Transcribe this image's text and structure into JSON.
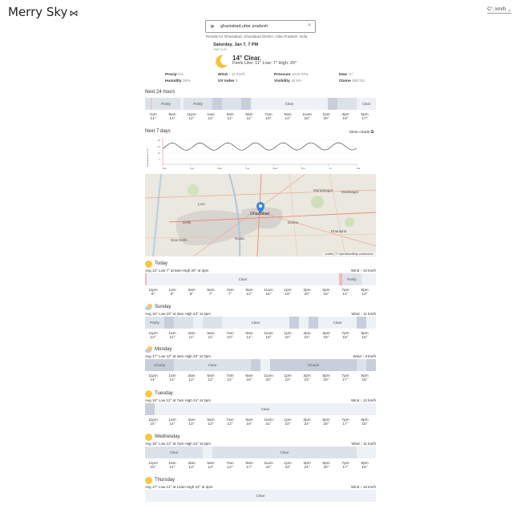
{
  "header": {
    "logo": "Merry Sky",
    "logo_icon": "butterfly-icon",
    "units": "C°, km/h"
  },
  "search": {
    "value": "ghaziabad,uttar pradesh",
    "results_text": "Results for Ghaziabad, Ghaziabad District, Uttar Pradesh, India"
  },
  "current": {
    "date": "Saturday, Jan 7, 7 PM",
    "tz": "GMT+5:30",
    "summary": "14° Clear.",
    "feels": "Feels Like: 11° Low: 7° High: 20°",
    "stats_row1": [
      {
        "label": "Precip",
        "value": "0%"
      },
      {
        "label": "Wind",
        "value": "↑ 11 km/h"
      },
      {
        "label": "Pressure",
        "value": "1016 hPa"
      },
      {
        "label": "Dew",
        "value": "-4°"
      }
    ],
    "stats_row2": [
      {
        "label": "Humidity",
        "value": "28%"
      },
      {
        "label": "UV Index",
        "value": "0"
      },
      {
        "label": "Visibility",
        "value": "16 km"
      },
      {
        "label": "Ozone",
        "value": "260 DU"
      }
    ]
  },
  "next24": {
    "title": "Next 24 hours",
    "labels": [
      "Partly",
      "Partly",
      "Clear",
      "Clear"
    ],
    "ticks": [
      {
        "t": "7pm",
        "v": "14°"
      },
      {
        "t": "9pm",
        "v": "13°"
      },
      {
        "t": "11pm",
        "v": "12°"
      },
      {
        "t": "1am",
        "v": "12°"
      },
      {
        "t": "3am",
        "v": "11°"
      },
      {
        "t": "5am",
        "v": "11°"
      },
      {
        "t": "7am",
        "v": "10°"
      },
      {
        "t": "9am",
        "v": "14°"
      },
      {
        "t": "11am",
        "v": "18°"
      },
      {
        "t": "1pm",
        "v": "20°"
      },
      {
        "t": "3pm",
        "v": "19°"
      },
      {
        "t": "5pm",
        "v": "17°"
      }
    ]
  },
  "next7": {
    "title": "Next 7 days",
    "more_charts": "More charts",
    "y_label": "Temperature (°C)",
    "y_ticks": [
      "30",
      "20",
      "10",
      "0"
    ],
    "x_labels": [
      "Sat",
      "Sun",
      "Mon",
      "Tue",
      "Wed",
      "Thu",
      "Fri",
      "Sat"
    ]
  },
  "map": {
    "city_label": "Ghaziabad",
    "labels": [
      "Delhi",
      "New Delhi",
      "Noida",
      "Loni",
      "Dhaulana",
      "Muradnagar",
      "Modinagar",
      "Dasna"
    ],
    "attribution": "Leaflet | © OpenStreetMap contributors"
  },
  "days": [
    {
      "name": "Today",
      "icon": "sun-icon",
      "meta": "Avg 13° Low 7° at 6am High 20° at 3pm",
      "wind": "Wind ↑ 10 km/h",
      "labels": [
        "Clear",
        "Partly"
      ],
      "ticks": [
        {
          "t": "11pm",
          "v": "9°"
        },
        {
          "t": "1am",
          "v": "8°"
        },
        {
          "t": "3am",
          "v": "8°"
        },
        {
          "t": "5am",
          "v": "7°"
        },
        {
          "t": "7am",
          "v": "7°"
        },
        {
          "t": "9am",
          "v": "12°"
        },
        {
          "t": "11am",
          "v": "16°"
        },
        {
          "t": "1pm",
          "v": "19°"
        },
        {
          "t": "3pm",
          "v": "20°"
        },
        {
          "t": "5pm",
          "v": "16°"
        },
        {
          "t": "7pm",
          "v": "14°"
        },
        {
          "t": "9pm",
          "v": "13°"
        }
      ]
    },
    {
      "name": "Sunday",
      "icon": "partly-cloudy-icon",
      "meta": "Avg 16° Low 10° at 3am High 23° at 3pm",
      "wind": "Wind ↑ 11 km/h",
      "labels": [
        "Partly",
        "Clear",
        "Clear"
      ],
      "ticks": [
        {
          "t": "11pm",
          "v": "12°"
        },
        {
          "t": "1am",
          "v": "12°"
        },
        {
          "t": "3am",
          "v": "11°"
        },
        {
          "t": "5am",
          "v": "11°"
        },
        {
          "t": "7am",
          "v": "10°"
        },
        {
          "t": "9am",
          "v": "14°"
        },
        {
          "t": "11am",
          "v": "18°"
        },
        {
          "t": "1pm",
          "v": "22°"
        },
        {
          "t": "3pm",
          "v": "23°"
        },
        {
          "t": "5pm",
          "v": "18°"
        },
        {
          "t": "7pm",
          "v": "16°"
        },
        {
          "t": "9pm",
          "v": "15°"
        }
      ]
    },
    {
      "name": "Monday",
      "icon": "partly-cloudy-icon",
      "meta": "Avg 17° Low 12° at 3am High 23° at 3pm",
      "wind": "Wind ↑ 9 km/h",
      "labels": [
        "Cloudy",
        "Clear",
        "Clouds"
      ],
      "ticks": [
        {
          "t": "11pm",
          "v": "14°"
        },
        {
          "t": "1am",
          "v": "14°"
        },
        {
          "t": "3am",
          "v": "13°"
        },
        {
          "t": "5am",
          "v": "12°"
        },
        {
          "t": "7am",
          "v": "12°"
        },
        {
          "t": "9am",
          "v": "16°"
        },
        {
          "t": "11am",
          "v": "20°"
        },
        {
          "t": "1pm",
          "v": "23°"
        },
        {
          "t": "3pm",
          "v": "23°"
        },
        {
          "t": "5pm",
          "v": "20°"
        },
        {
          "t": "7pm",
          "v": "17°"
        },
        {
          "t": "9pm",
          "v": "16°"
        }
      ]
    },
    {
      "name": "Tuesday",
      "icon": "sun-icon",
      "meta": "Avg 18° Low 12° at 7am High 24° at 3pm",
      "wind": "Wind ↑ 12 km/h",
      "labels": [
        "Clear"
      ],
      "ticks": [
        {
          "t": "11pm",
          "v": "15°"
        },
        {
          "t": "1am",
          "v": "14°"
        },
        {
          "t": "3am",
          "v": "13°"
        },
        {
          "t": "5am",
          "v": "13°"
        },
        {
          "t": "7am",
          "v": "12°"
        },
        {
          "t": "9am",
          "v": "16°"
        },
        {
          "t": "11am",
          "v": "21°"
        },
        {
          "t": "1pm",
          "v": "23°"
        },
        {
          "t": "3pm",
          "v": "24°"
        },
        {
          "t": "5pm",
          "v": "20°"
        },
        {
          "t": "7pm",
          "v": "17°"
        },
        {
          "t": "9pm",
          "v": "16°"
        }
      ]
    },
    {
      "name": "Wednesday",
      "icon": "sun-icon",
      "meta": "Avg 18° Low 12° at 7am High 24° at 3pm",
      "wind": "Wind ↑ 11 km/h",
      "labels": [
        "Clear",
        "Clear"
      ],
      "ticks": [
        {
          "t": "11pm",
          "v": "15°"
        },
        {
          "t": "1am",
          "v": "14°"
        },
        {
          "t": "3am",
          "v": "13°"
        },
        {
          "t": "5am",
          "v": "13°"
        },
        {
          "t": "7am",
          "v": "12°"
        },
        {
          "t": "9am",
          "v": "17°"
        },
        {
          "t": "11am",
          "v": "22°"
        },
        {
          "t": "1pm",
          "v": "23°"
        },
        {
          "t": "3pm",
          "v": "24°"
        },
        {
          "t": "5pm",
          "v": "20°"
        },
        {
          "t": "7pm",
          "v": "17°"
        },
        {
          "t": "9pm",
          "v": "16°"
        }
      ]
    },
    {
      "name": "Thursday",
      "icon": "sun-icon",
      "meta": "Avg 17° Low 12° at 12am High 23° at 3pm",
      "wind": "Wind ↑ 15 km/h",
      "labels": [
        "Clear"
      ],
      "ticks": []
    }
  ]
}
